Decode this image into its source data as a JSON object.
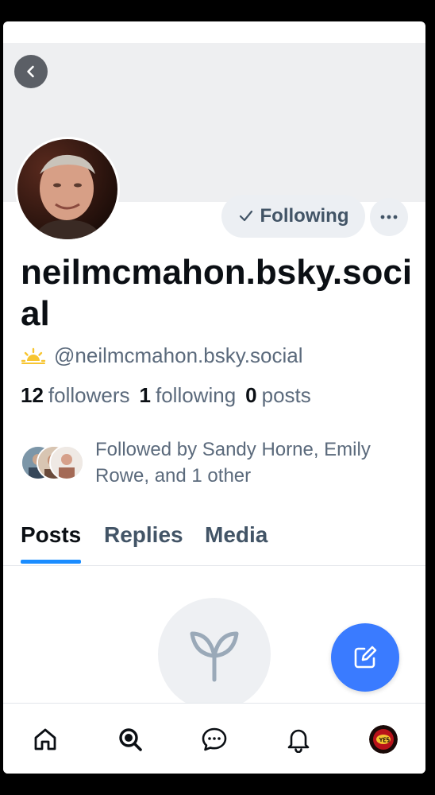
{
  "profile": {
    "display_name": "neilmcmahon.bsky.social",
    "handle": "@neilmcmahon.bsky.social",
    "handle_icon": "sun-horizon-icon"
  },
  "actions": {
    "following_label": "Following",
    "more_icon": "more-icon"
  },
  "stats": {
    "followers_count": "12",
    "followers_label": "followers",
    "following_count": "1",
    "following_label": "following",
    "posts_count": "0",
    "posts_label": "posts"
  },
  "followed_by": {
    "text": "Followed by Sandy Horne, Emily Rowe, and 1 other"
  },
  "tabs": [
    {
      "label": "Posts",
      "active": true
    },
    {
      "label": "Replies",
      "active": false
    },
    {
      "label": "Media",
      "active": false
    }
  ],
  "bottom_nav": [
    {
      "icon": "home-icon"
    },
    {
      "icon": "search-icon"
    },
    {
      "icon": "chat-icon"
    },
    {
      "icon": "bell-icon"
    },
    {
      "icon": "profile-avatar"
    }
  ],
  "colors": {
    "accent": "#1a8cff",
    "compose": "#3a7bff",
    "muted_text": "#5b6a7c",
    "banner": "#eeeff1"
  }
}
